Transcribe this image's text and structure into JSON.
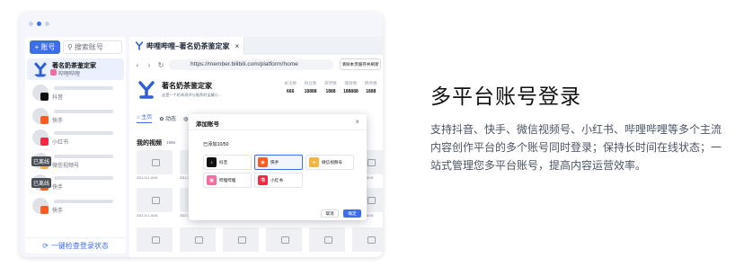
{
  "sidebar": {
    "add_label": "账号",
    "search_placeholder": "搜索账号",
    "active_account": {
      "name": "著名奶茶鉴定家",
      "platform": "哔哩哔哩"
    },
    "accounts": [
      {
        "platform": "抖音",
        "badge_color": "#111111",
        "offline": ""
      },
      {
        "platform": "快手",
        "badge_color": "#ff5a1f",
        "offline": ""
      },
      {
        "platform": "小红书",
        "badge_color": "#ff2442",
        "offline": ""
      },
      {
        "platform": "微信视频号",
        "badge_color": "#f3b441",
        "offline": "已离线"
      },
      {
        "platform": "快手",
        "badge_color": "#ff5a1f",
        "offline": "已离线"
      },
      {
        "platform": "快手",
        "badge_color": "#ff5a1f",
        "offline": ""
      }
    ],
    "check_all": "一键检查登录状态"
  },
  "browser": {
    "tab_title": "哔哩哔哩–著名奶茶鉴定家",
    "tab_close": "×",
    "url": "https://member.bilibili.com/platform/home",
    "clear_button": "清除本页缓存并刷新"
  },
  "profile": {
    "name": "著名奶茶鉴定家",
    "desc": "这是一个奶茶测评与推荐的宝藏小…",
    "stats": [
      {
        "label": "关注数",
        "value": "666"
      },
      {
        "label": "粉丝数",
        "value": "18888"
      },
      {
        "label": "获赞数",
        "value": "1888"
      },
      {
        "label": "播放数",
        "value": "188888"
      },
      {
        "label": "稿件数",
        "value": "1888"
      }
    ],
    "tabs": [
      "主页",
      "动态",
      "投稿"
    ]
  },
  "videos": {
    "title": "我的视频",
    "count": "1988",
    "meta": [
      "2021-10-1  18:00",
      "2022-10-1  18:00"
    ]
  },
  "modal": {
    "title": "添加账号",
    "close": "×",
    "count": "已添加10/50",
    "platforms": [
      {
        "name": "抖音",
        "icon": "douyin-icon",
        "color": "#111111",
        "glyph": "♪"
      },
      {
        "name": "快手",
        "icon": "kuaishou-icon",
        "color": "#ff5a1f",
        "glyph": "◉"
      },
      {
        "name": "微信视频号",
        "icon": "wechat-channels-icon",
        "color": "#f3b441",
        "glyph": "∞"
      },
      {
        "name": "哔哩哔哩",
        "icon": "bilibili-icon",
        "color": "#f06fa0",
        "glyph": "▣"
      },
      {
        "name": "小红书",
        "icon": "xiaohongshu-icon",
        "color": "#ff2442",
        "glyph": "书"
      }
    ],
    "cancel": "取消",
    "ok": "确定"
  },
  "copy": {
    "headline": "多平台账号登录",
    "body": "支持抖音、快手、微信视频号、小红书、哔哩哔哩等多个主流内容创作平台的多个账号同时登录；保持长时间在线状态；一站式管理您多平台账号，提高内容运营效率。"
  }
}
